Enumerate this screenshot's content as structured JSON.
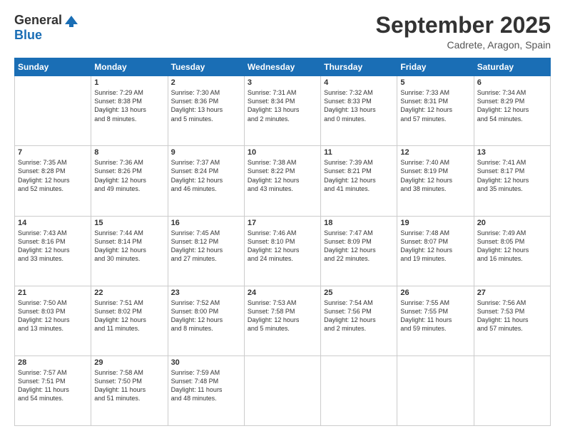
{
  "header": {
    "logo_general": "General",
    "logo_blue": "Blue",
    "month_title": "September 2025",
    "location": "Cadrete, Aragon, Spain"
  },
  "days_of_week": [
    "Sunday",
    "Monday",
    "Tuesday",
    "Wednesday",
    "Thursday",
    "Friday",
    "Saturday"
  ],
  "weeks": [
    [
      {
        "day": "",
        "info": ""
      },
      {
        "day": "1",
        "info": "Sunrise: 7:29 AM\nSunset: 8:38 PM\nDaylight: 13 hours\nand 8 minutes."
      },
      {
        "day": "2",
        "info": "Sunrise: 7:30 AM\nSunset: 8:36 PM\nDaylight: 13 hours\nand 5 minutes."
      },
      {
        "day": "3",
        "info": "Sunrise: 7:31 AM\nSunset: 8:34 PM\nDaylight: 13 hours\nand 2 minutes."
      },
      {
        "day": "4",
        "info": "Sunrise: 7:32 AM\nSunset: 8:33 PM\nDaylight: 13 hours\nand 0 minutes."
      },
      {
        "day": "5",
        "info": "Sunrise: 7:33 AM\nSunset: 8:31 PM\nDaylight: 12 hours\nand 57 minutes."
      },
      {
        "day": "6",
        "info": "Sunrise: 7:34 AM\nSunset: 8:29 PM\nDaylight: 12 hours\nand 54 minutes."
      }
    ],
    [
      {
        "day": "7",
        "info": "Sunrise: 7:35 AM\nSunset: 8:28 PM\nDaylight: 12 hours\nand 52 minutes."
      },
      {
        "day": "8",
        "info": "Sunrise: 7:36 AM\nSunset: 8:26 PM\nDaylight: 12 hours\nand 49 minutes."
      },
      {
        "day": "9",
        "info": "Sunrise: 7:37 AM\nSunset: 8:24 PM\nDaylight: 12 hours\nand 46 minutes."
      },
      {
        "day": "10",
        "info": "Sunrise: 7:38 AM\nSunset: 8:22 PM\nDaylight: 12 hours\nand 43 minutes."
      },
      {
        "day": "11",
        "info": "Sunrise: 7:39 AM\nSunset: 8:21 PM\nDaylight: 12 hours\nand 41 minutes."
      },
      {
        "day": "12",
        "info": "Sunrise: 7:40 AM\nSunset: 8:19 PM\nDaylight: 12 hours\nand 38 minutes."
      },
      {
        "day": "13",
        "info": "Sunrise: 7:41 AM\nSunset: 8:17 PM\nDaylight: 12 hours\nand 35 minutes."
      }
    ],
    [
      {
        "day": "14",
        "info": "Sunrise: 7:43 AM\nSunset: 8:16 PM\nDaylight: 12 hours\nand 33 minutes."
      },
      {
        "day": "15",
        "info": "Sunrise: 7:44 AM\nSunset: 8:14 PM\nDaylight: 12 hours\nand 30 minutes."
      },
      {
        "day": "16",
        "info": "Sunrise: 7:45 AM\nSunset: 8:12 PM\nDaylight: 12 hours\nand 27 minutes."
      },
      {
        "day": "17",
        "info": "Sunrise: 7:46 AM\nSunset: 8:10 PM\nDaylight: 12 hours\nand 24 minutes."
      },
      {
        "day": "18",
        "info": "Sunrise: 7:47 AM\nSunset: 8:09 PM\nDaylight: 12 hours\nand 22 minutes."
      },
      {
        "day": "19",
        "info": "Sunrise: 7:48 AM\nSunset: 8:07 PM\nDaylight: 12 hours\nand 19 minutes."
      },
      {
        "day": "20",
        "info": "Sunrise: 7:49 AM\nSunset: 8:05 PM\nDaylight: 12 hours\nand 16 minutes."
      }
    ],
    [
      {
        "day": "21",
        "info": "Sunrise: 7:50 AM\nSunset: 8:03 PM\nDaylight: 12 hours\nand 13 minutes."
      },
      {
        "day": "22",
        "info": "Sunrise: 7:51 AM\nSunset: 8:02 PM\nDaylight: 12 hours\nand 11 minutes."
      },
      {
        "day": "23",
        "info": "Sunrise: 7:52 AM\nSunset: 8:00 PM\nDaylight: 12 hours\nand 8 minutes."
      },
      {
        "day": "24",
        "info": "Sunrise: 7:53 AM\nSunset: 7:58 PM\nDaylight: 12 hours\nand 5 minutes."
      },
      {
        "day": "25",
        "info": "Sunrise: 7:54 AM\nSunset: 7:56 PM\nDaylight: 12 hours\nand 2 minutes."
      },
      {
        "day": "26",
        "info": "Sunrise: 7:55 AM\nSunset: 7:55 PM\nDaylight: 11 hours\nand 59 minutes."
      },
      {
        "day": "27",
        "info": "Sunrise: 7:56 AM\nSunset: 7:53 PM\nDaylight: 11 hours\nand 57 minutes."
      }
    ],
    [
      {
        "day": "28",
        "info": "Sunrise: 7:57 AM\nSunset: 7:51 PM\nDaylight: 11 hours\nand 54 minutes."
      },
      {
        "day": "29",
        "info": "Sunrise: 7:58 AM\nSunset: 7:50 PM\nDaylight: 11 hours\nand 51 minutes."
      },
      {
        "day": "30",
        "info": "Sunrise: 7:59 AM\nSunset: 7:48 PM\nDaylight: 11 hours\nand 48 minutes."
      },
      {
        "day": "",
        "info": ""
      },
      {
        "day": "",
        "info": ""
      },
      {
        "day": "",
        "info": ""
      },
      {
        "day": "",
        "info": ""
      }
    ]
  ]
}
